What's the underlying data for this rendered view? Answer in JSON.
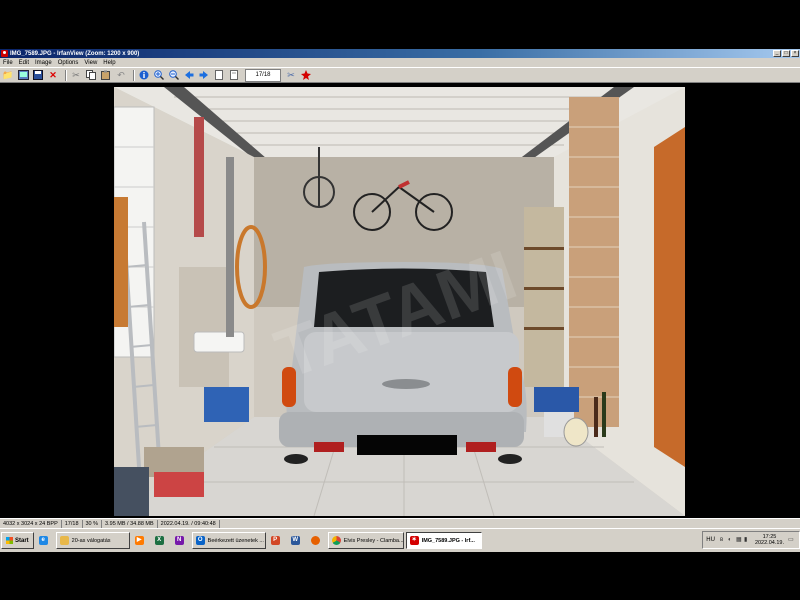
{
  "window": {
    "title": "IMG_7589.JPG - IrfanView (Zoom: 1200 x 900)",
    "minimize": "_",
    "maximize": "□",
    "close": "×"
  },
  "menu": [
    "File",
    "Edit",
    "Image",
    "Options",
    "View",
    "Help"
  ],
  "toolbar": {
    "page_value": "17/18",
    "icons": [
      "open-folder-icon",
      "thumbnails-icon",
      "save-icon",
      "delete-icon",
      "cut-icon",
      "copy-icon",
      "paste-icon",
      "undo-icon",
      "info-icon",
      "zoom-in-icon",
      "zoom-out-icon",
      "prev-icon",
      "next-icon",
      "first-page-icon",
      "last-page-icon"
    ]
  },
  "image": {
    "file": "IMG_7589.JPG",
    "watermark": "TATAMI"
  },
  "statusbar": {
    "dimensions": "4032 x 3024 x 24 BPP",
    "index": "17/18",
    "zoom": "30 %",
    "size": "3.95 MB / 34.88 MB",
    "datetime": "2022.04.19. / 09:40:48"
  },
  "taskbar": {
    "start": "Start",
    "tasks": [
      {
        "label": "",
        "icon": "ie-icon",
        "color": "#1e88e5"
      },
      {
        "label": "20-as válogatás",
        "icon": "folder-icon",
        "color": "#e8b84a"
      },
      {
        "label": "",
        "icon": "media-player-icon",
        "color": "#ff7a00"
      },
      {
        "label": "",
        "icon": "excel-icon",
        "color": "#1d6f42"
      },
      {
        "label": "",
        "icon": "onenote-icon",
        "color": "#7719aa"
      },
      {
        "label": "Beérkezett üzenetek ...",
        "icon": "outlook-icon",
        "color": "#0a64c8"
      },
      {
        "label": "",
        "icon": "powerpoint-icon",
        "color": "#d24726"
      },
      {
        "label": "",
        "icon": "word-icon",
        "color": "#2b579a"
      },
      {
        "label": "",
        "icon": "firefox-icon",
        "color": "#e66000"
      },
      {
        "label": "Elvis Presley - Clamba...",
        "icon": "chrome-icon",
        "color": "#4285f4"
      },
      {
        "label": "IMG_7589.JPG - Irf...",
        "icon": "irfanview-icon",
        "color": "#d40000",
        "active": true
      }
    ],
    "tray": {
      "lang": "HU",
      "time": "17:25",
      "date": "2022.04.19."
    }
  }
}
